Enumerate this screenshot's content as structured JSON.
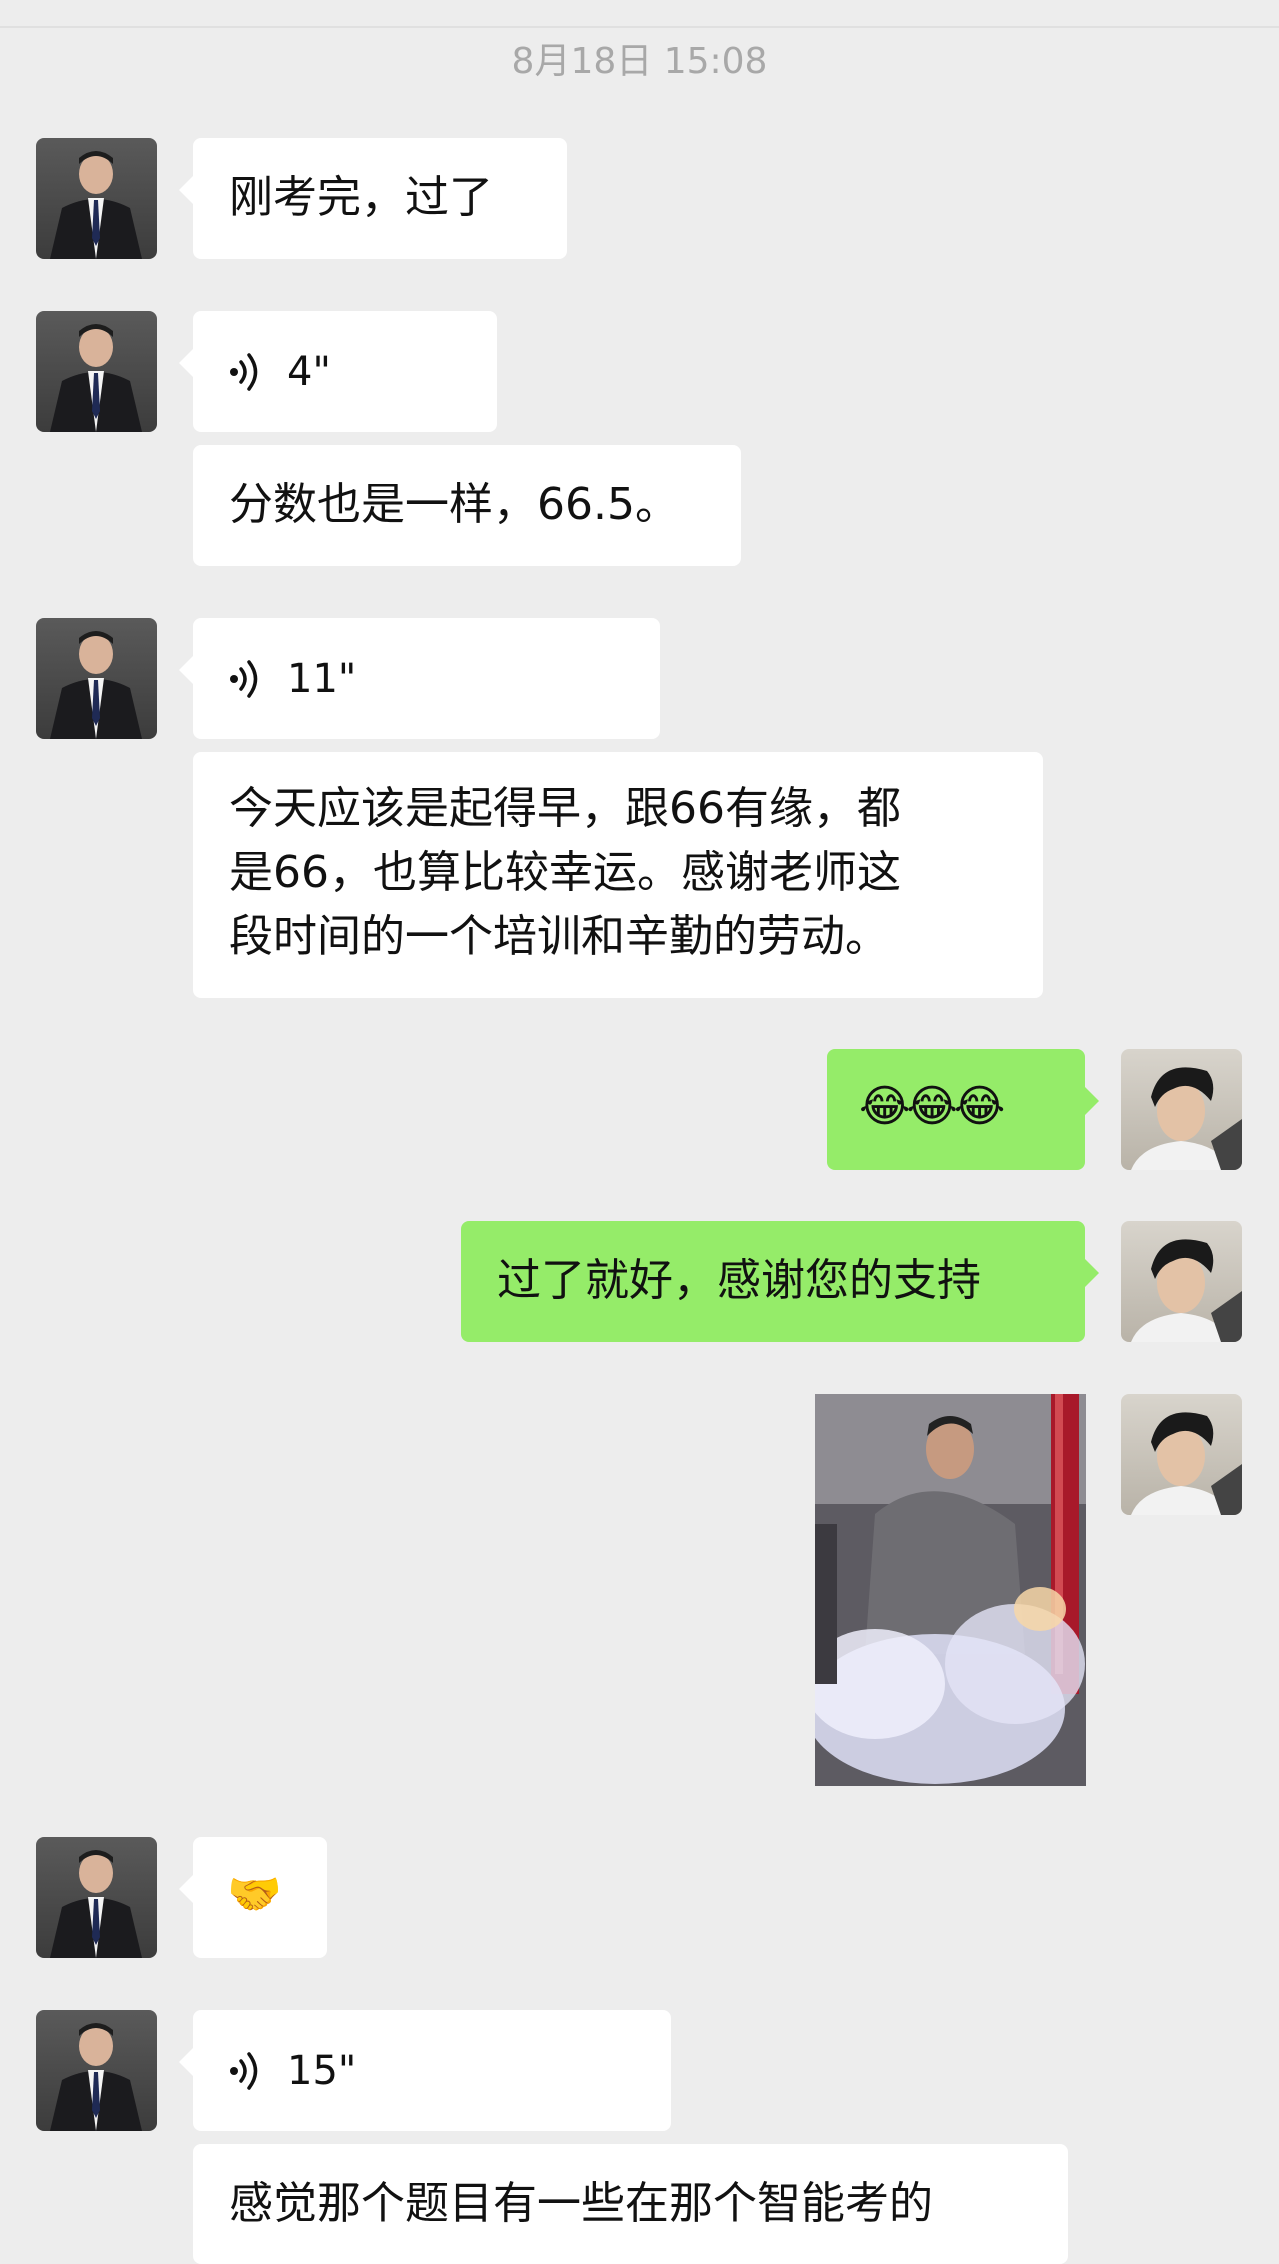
{
  "timestamp": "8月18日 15:08",
  "icons": {
    "voice": "voice-wave-icon",
    "laughing": "tears-of-joy-emoji",
    "handshake": "handshake-emoji"
  },
  "colors": {
    "incoming_bubble": "#ffffff",
    "outgoing_bubble": "#95ec69",
    "background": "#ededed"
  },
  "messages": {
    "m1": "刚考完，过了",
    "v1": "4\"",
    "m2": "分数也是一样，66.5。",
    "v2": "11\"",
    "m3_line1": "今天应该是起得早，跟66有缘，都",
    "m3_line2": "是66，也算比较幸运。感谢老师这",
    "m3_line3": "段时间的一个培训和辛勤的劳动。",
    "m4_emoji": "😂😂😂",
    "m5": "过了就好，感谢您的支持",
    "m7_emoji": "🤝",
    "v3": "15\"",
    "m8": "感觉那个题目有一些在那个智能考的"
  }
}
